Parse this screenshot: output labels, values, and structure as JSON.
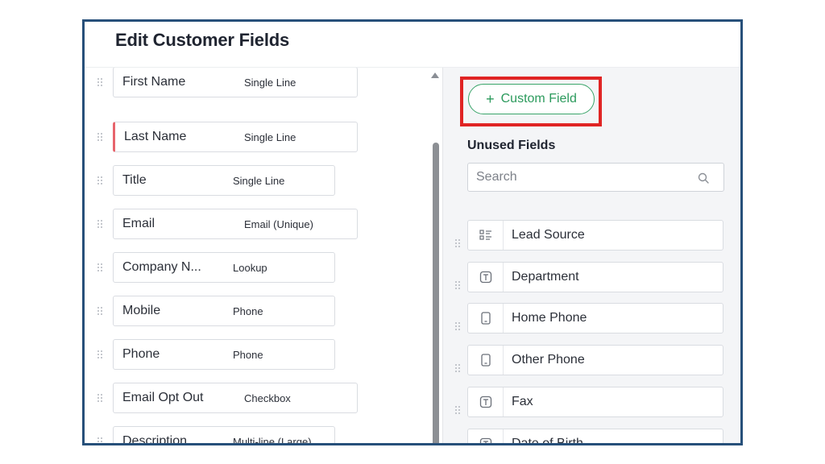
{
  "header": {
    "title": "Edit Customer Fields"
  },
  "fields": [
    {
      "name": "First Name",
      "type": "Single Line"
    },
    {
      "name": "Last Name",
      "type": "Single Line"
    },
    {
      "name": "Title",
      "type": "Single Line"
    },
    {
      "name": "Email",
      "type": "Email  (Unique)"
    },
    {
      "name": "Company N...",
      "type": "Lookup"
    },
    {
      "name": "Mobile",
      "type": "Phone"
    },
    {
      "name": "Phone",
      "type": "Phone"
    },
    {
      "name": "Email Opt Out",
      "type": "Checkbox"
    },
    {
      "name": "Description",
      "type": "Multi-line (Large)"
    }
  ],
  "right_panel": {
    "custom_field_button": {
      "label": "Custom Field",
      "icon": "plus-icon"
    },
    "unused_title": "Unused Fields",
    "search": {
      "placeholder": "Search",
      "value": "",
      "icon": "search-icon"
    },
    "unused_fields": [
      {
        "label": "Lead Source",
        "icon": "picklist-icon"
      },
      {
        "label": "Department",
        "icon": "text-field-icon"
      },
      {
        "label": "Home Phone",
        "icon": "phone-icon"
      },
      {
        "label": "Other Phone",
        "icon": "phone-icon"
      },
      {
        "label": "Fax",
        "icon": "text-field-icon"
      },
      {
        "label": "Date of Birth",
        "icon": "text-field-icon"
      }
    ]
  },
  "colors": {
    "frame_border": "#27507a",
    "accent_green": "#2b9a5c",
    "highlight_red": "#e02424",
    "active_marker": "#e7646c"
  }
}
